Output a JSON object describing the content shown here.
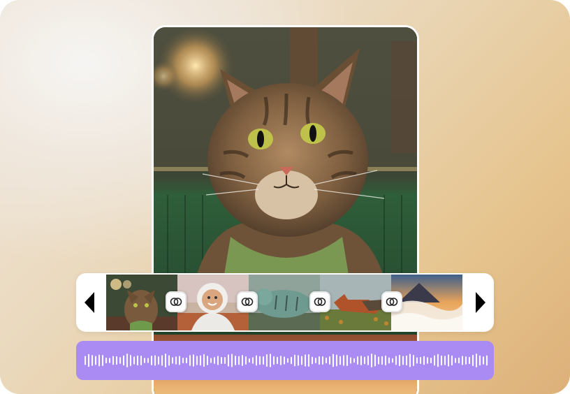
{
  "preview": {
    "subject": "cat",
    "icon": "cat-portrait-image"
  },
  "timeline": {
    "nav_left_icon": "triangle-left-icon",
    "nav_right_icon": "triangle-right-icon",
    "clips": [
      {
        "name": "clip-cat"
      },
      {
        "name": "clip-astronaut"
      },
      {
        "name": "clip-tiger"
      },
      {
        "name": "clip-wolf"
      },
      {
        "name": "clip-landscape"
      }
    ],
    "transition_icon": "transition-rings-icon"
  },
  "audio": {
    "icon": "waveform",
    "color": "#a98bf3"
  },
  "colors": {
    "accent": "#a98bf3",
    "panel": "#ffffff",
    "background": "#eadcc6"
  }
}
